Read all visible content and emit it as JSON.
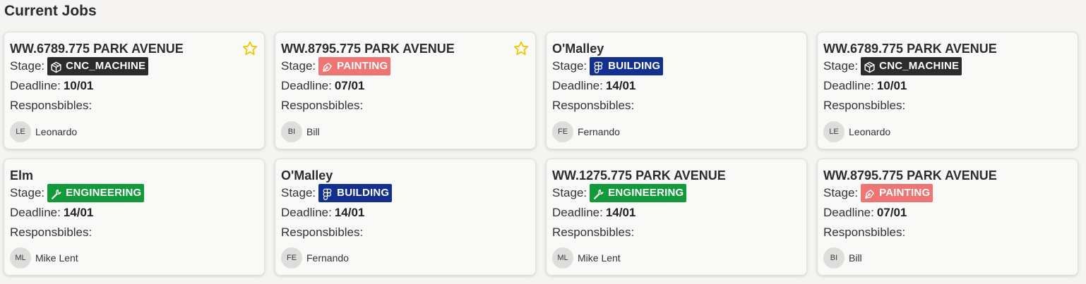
{
  "page": {
    "title": "Current Jobs"
  },
  "labels": {
    "stage": "Stage:",
    "deadline": "Deadline:",
    "responsibles": "Responsbibles:"
  },
  "colors": {
    "CNC_MACHINE": "#2c2c2c",
    "PAINTING": "#ef7474",
    "BUILDING": "#13308f",
    "ENGINEERING": "#129a3a",
    "star": "#f2c500"
  },
  "jobs": [
    {
      "title": "WW.6789.775 PARK AVENUE",
      "starred": true,
      "stage": "CNC_MACHINE",
      "stage_icon": "cube-icon",
      "deadline": "10/01",
      "responsible": {
        "initials": "LE",
        "name": "Leonardo"
      }
    },
    {
      "title": "WW.8795.775 PARK AVENUE",
      "starred": true,
      "stage": "PAINTING",
      "stage_icon": "pen-tool-icon",
      "deadline": "07/01",
      "responsible": {
        "initials": "BI",
        "name": "Bill"
      }
    },
    {
      "title": "O'Malley",
      "starred": false,
      "stage": "BUILDING",
      "stage_icon": "figma-icon",
      "deadline": "14/01",
      "responsible": {
        "initials": "FE",
        "name": "Fernando"
      }
    },
    {
      "title": "WW.6789.775 PARK AVENUE",
      "starred": false,
      "stage": "CNC_MACHINE",
      "stage_icon": "cube-icon",
      "deadline": "10/01",
      "responsible": {
        "initials": "LE",
        "name": "Leonardo"
      }
    },
    {
      "title": "Elm",
      "starred": false,
      "stage": "ENGINEERING",
      "stage_icon": "wrench-icon",
      "deadline": "14/01",
      "responsible": {
        "initials": "ML",
        "name": "Mike Lent"
      }
    },
    {
      "title": "O'Malley",
      "starred": false,
      "stage": "BUILDING",
      "stage_icon": "figma-icon",
      "deadline": "14/01",
      "responsible": {
        "initials": "FE",
        "name": "Fernando"
      }
    },
    {
      "title": "WW.1275.775 PARK AVENUE",
      "starred": false,
      "stage": "ENGINEERING",
      "stage_icon": "wrench-icon",
      "deadline": "14/01",
      "responsible": {
        "initials": "ML",
        "name": "Mike Lent"
      }
    },
    {
      "title": "WW.8795.775 PARK AVENUE",
      "starred": false,
      "stage": "PAINTING",
      "stage_icon": "pen-tool-icon",
      "deadline": "07/01",
      "responsible": {
        "initials": "BI",
        "name": "Bill"
      }
    }
  ]
}
